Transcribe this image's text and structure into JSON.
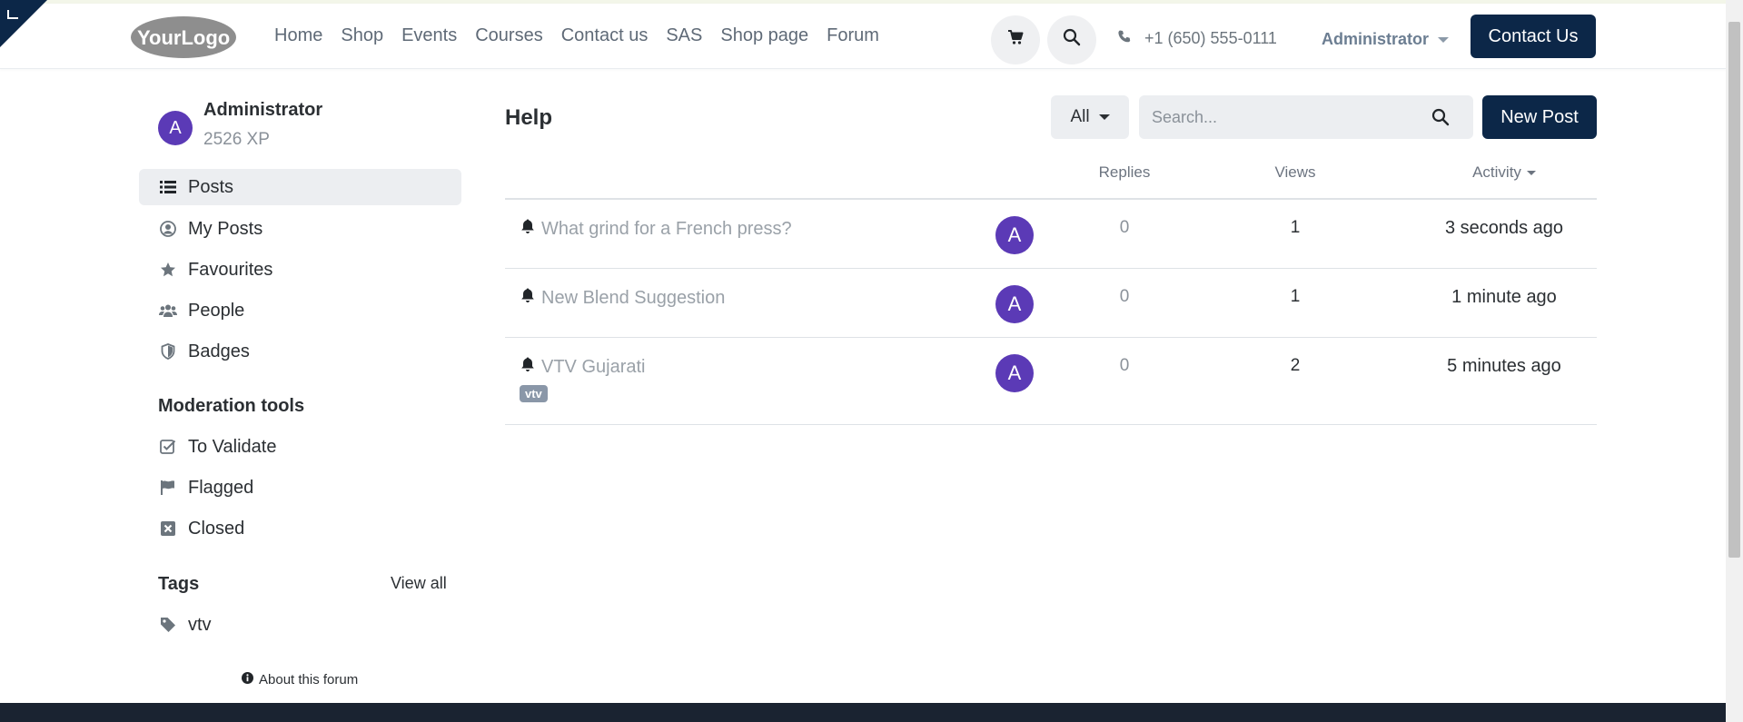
{
  "header": {
    "logo_text": "YourLogo",
    "nav": [
      "Home",
      "Shop",
      "Events",
      "Courses",
      "Contact us",
      "SAS",
      "Shop page",
      "Forum"
    ],
    "phone": "+1 (650) 555-0111",
    "user_menu": "Administrator",
    "contact_button": "Contact Us",
    "icons": {
      "cart": "cart-icon",
      "search": "search-icon",
      "phone": "phone-icon"
    }
  },
  "sidebar": {
    "user": {
      "initial": "A",
      "name": "Administrator",
      "xp": "2526 XP"
    },
    "items": [
      {
        "label": "Posts",
        "icon": "list-icon",
        "active": true
      },
      {
        "label": "My Posts",
        "icon": "user-circle-icon"
      },
      {
        "label": "Favourites",
        "icon": "star-icon"
      },
      {
        "label": "People",
        "icon": "users-icon"
      },
      {
        "label": "Badges",
        "icon": "shield-icon"
      }
    ],
    "moderation_heading": "Moderation tools",
    "moderation": [
      {
        "label": "To Validate",
        "icon": "check-square-icon"
      },
      {
        "label": "Flagged",
        "icon": "flag-icon"
      },
      {
        "label": "Closed",
        "icon": "x-square-icon"
      }
    ],
    "tags_heading": "Tags",
    "view_all": "View all",
    "tags": [
      {
        "label": "vtv",
        "icon": "tag-icon"
      }
    ],
    "about": "About this forum"
  },
  "main": {
    "title": "Help",
    "filter": "All",
    "search_placeholder": "Search...",
    "new_post": "New Post",
    "columns": {
      "replies": "Replies",
      "views": "Views",
      "activity": "Activity"
    },
    "posts": [
      {
        "title": "What grind for a French press?",
        "author_initial": "A",
        "replies": "0",
        "views": "1",
        "activity": "3 seconds ago"
      },
      {
        "title": "New Blend Suggestion",
        "author_initial": "A",
        "replies": "0",
        "views": "1",
        "activity": "1 minute ago"
      },
      {
        "title": "VTV Gujarati",
        "author_initial": "A",
        "replies": "0",
        "views": "2",
        "activity": "5 minutes ago",
        "tag": "vtv"
      }
    ]
  },
  "colors": {
    "primary": "#0c2748",
    "avatar": "#5b3ab6",
    "muted_link": "#9aa1a8"
  }
}
